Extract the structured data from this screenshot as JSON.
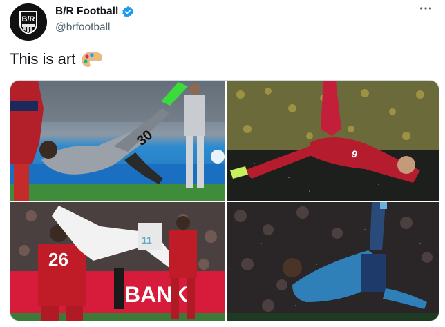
{
  "header": {
    "account_name": "B/R Football",
    "handle": "@brfootball",
    "avatar_text": "B/R",
    "verified_icon": "verified-badge-icon",
    "more_icon": "more-horizontal-icon"
  },
  "tweet": {
    "text": "This is art",
    "emoji": "artist-palette-icon"
  },
  "media": {
    "photos": [
      {
        "subject": "messi-bicycle-kick-photo",
        "jersey_number": "30"
      },
      {
        "subject": "lewandowski-bicycle-kick-photo",
        "jersey_number": "9"
      },
      {
        "subject": "bale-bicycle-kick-photo",
        "jersey_number": "26",
        "banner_text": "BANK"
      },
      {
        "subject": "ronaldo-bicycle-kick-photo",
        "jersey_number": ""
      }
    ]
  },
  "colors": {
    "verified_blue": "#1d9bf0",
    "handle_gray": "#536471",
    "text_black": "#0f1419"
  }
}
